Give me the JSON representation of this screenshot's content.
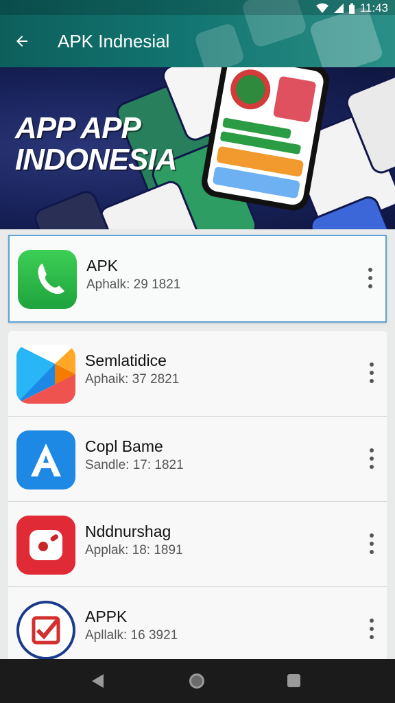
{
  "status": {
    "time": "11:43"
  },
  "appbar": {
    "title": "APK Indnesial"
  },
  "banner": {
    "line1": "APP APP",
    "line2": "INDONESIA"
  },
  "apps": [
    {
      "name": "APK",
      "sub": "Aphalk: 29 1821",
      "icon": "whatsapp-style-icon",
      "selected": true
    },
    {
      "name": "Semlatidice",
      "sub": "Aphaik: 37 2821",
      "icon": "play-triangle-icon"
    },
    {
      "name": "Copl Bame",
      "sub": "Sandle: 17: 1821",
      "icon": "letter-a-icon"
    },
    {
      "name": "Nddnurshag",
      "sub": "Applak: 18: 1891",
      "icon": "red-camera-icon"
    },
    {
      "name": "APPK",
      "sub": "Apllalk: 16 3921",
      "icon": "checkbox-seal-icon"
    }
  ],
  "colors": {
    "accent": "#0d5f5c",
    "selected_border": "#5ea3d6",
    "banner": "#182259"
  }
}
